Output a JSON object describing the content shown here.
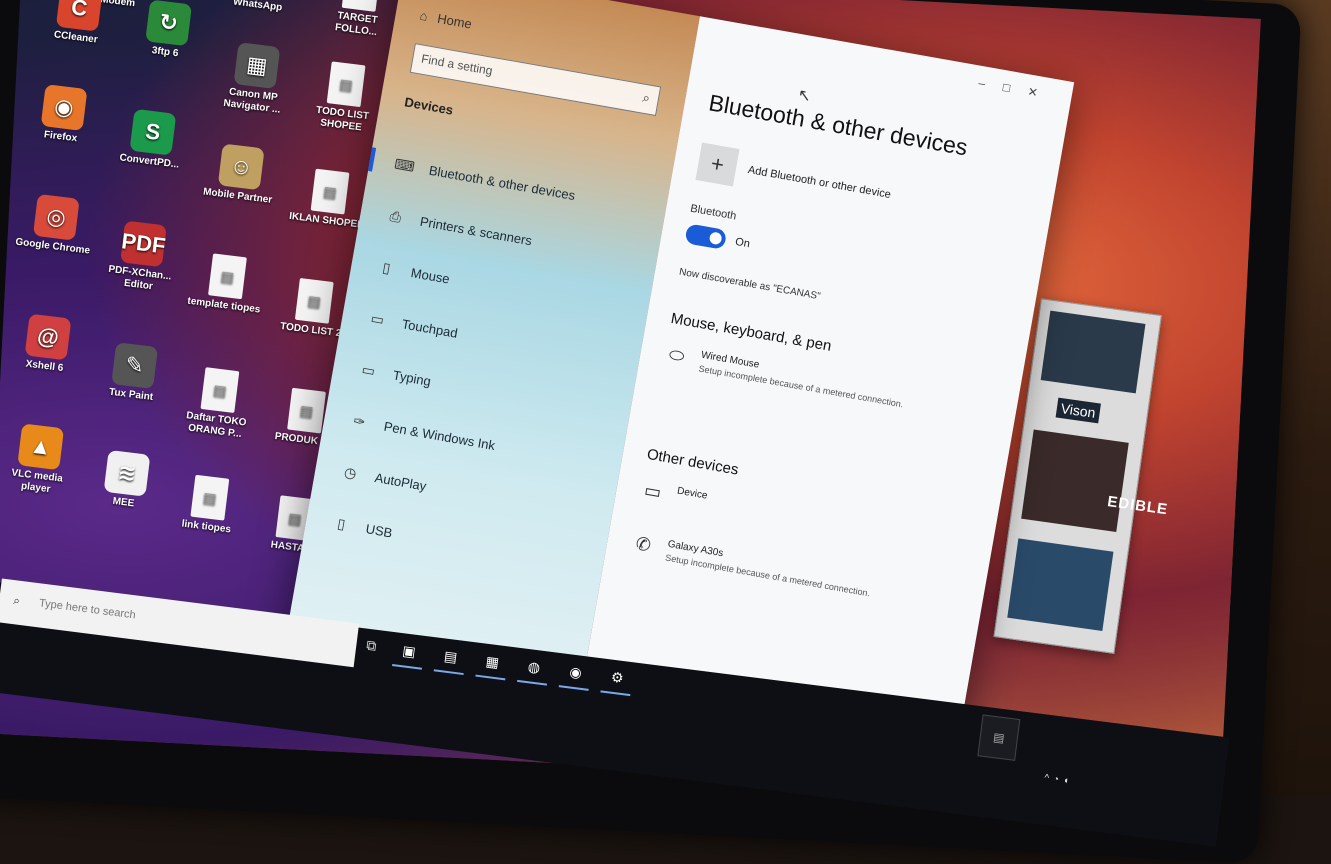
{
  "desktop": {
    "icons": [
      {
        "label": "Modem",
        "glyph": "☎"
      },
      {
        "label": "WhatsApp",
        "glyph": "✆"
      },
      {
        "label": "TARGET FOLLO...",
        "glyph": "▤"
      },
      {
        "label": "CCleaner",
        "glyph": "C"
      },
      {
        "label": "3ftp 6",
        "glyph": "↻"
      },
      {
        "label": "Canon MP Navigator ...",
        "glyph": "▦"
      },
      {
        "label": "TODO LIST SHOPEE",
        "glyph": "▤"
      },
      {
        "label": "Firefox",
        "glyph": "◉"
      },
      {
        "label": "ConvertPD...",
        "glyph": "S"
      },
      {
        "label": "Mobile Partner",
        "glyph": "☺"
      },
      {
        "label": "IKLAN SHOPEE",
        "glyph": "▤"
      },
      {
        "label": "Google Chrome",
        "glyph": "◎"
      },
      {
        "label": "PDF-XChan... Editor",
        "glyph": "PDF"
      },
      {
        "label": "template tiopes",
        "glyph": "▤"
      },
      {
        "label": "TODO LIST 2",
        "glyph": "▤"
      },
      {
        "label": "Xshell 6",
        "glyph": "@"
      },
      {
        "label": "Tux Paint",
        "glyph": "✎"
      },
      {
        "label": "Daftar TOKO ORANG P...",
        "glyph": "▤"
      },
      {
        "label": "PRODUK IG",
        "glyph": "▤"
      },
      {
        "label": "VLC media player",
        "glyph": "▲"
      },
      {
        "label": "MEE",
        "glyph": "≋"
      },
      {
        "label": "link tiopes",
        "glyph": "▤"
      },
      {
        "label": "HASTAG",
        "glyph": "▤"
      }
    ]
  },
  "settings": {
    "nav": {
      "home": "Home",
      "search_placeholder": "Find a setting",
      "category": "Devices",
      "items": [
        {
          "label": "Bluetooth & other devices",
          "icon": "bluetooth-icon",
          "glyph": "⌨",
          "active": true
        },
        {
          "label": "Printers & scanners",
          "icon": "printer-icon",
          "glyph": "⎙"
        },
        {
          "label": "Mouse",
          "icon": "mouse-icon",
          "glyph": "▯"
        },
        {
          "label": "Touchpad",
          "icon": "touchpad-icon",
          "glyph": "▭"
        },
        {
          "label": "Typing",
          "icon": "keyboard-icon",
          "glyph": "▭"
        },
        {
          "label": "Pen & Windows Ink",
          "icon": "pen-icon",
          "glyph": "✑"
        },
        {
          "label": "AutoPlay",
          "icon": "autoplay-icon",
          "glyph": "◷"
        },
        {
          "label": "USB",
          "icon": "usb-icon",
          "glyph": "▯"
        }
      ]
    },
    "content": {
      "title": "Bluetooth & other devices",
      "add_label": "Add Bluetooth or other device",
      "bluetooth_label": "Bluetooth",
      "bluetooth_state": "On",
      "discoverable": "Now discoverable as \"ECANAS\"",
      "section_mouse": "Mouse, keyboard, & pen",
      "mouse_device": {
        "name": "Wired Mouse",
        "status": "Setup incomplete because of a metered connection."
      },
      "section_other": "Other devices",
      "other_device": {
        "name": "Device"
      },
      "phone_device": {
        "name": "Galaxy A30s",
        "status": "Setup incomplete because of a metered connection."
      }
    }
  },
  "sidewin": {
    "label": "Vison"
  },
  "wallpaper_text": "EDIBLE",
  "taskbar": {
    "search_placeholder": "Type here to search",
    "apps": [
      "▣",
      "▤",
      "▦",
      "◍",
      "◉",
      "⚙"
    ]
  },
  "colors": {
    "accent": "#1a5bd8"
  }
}
